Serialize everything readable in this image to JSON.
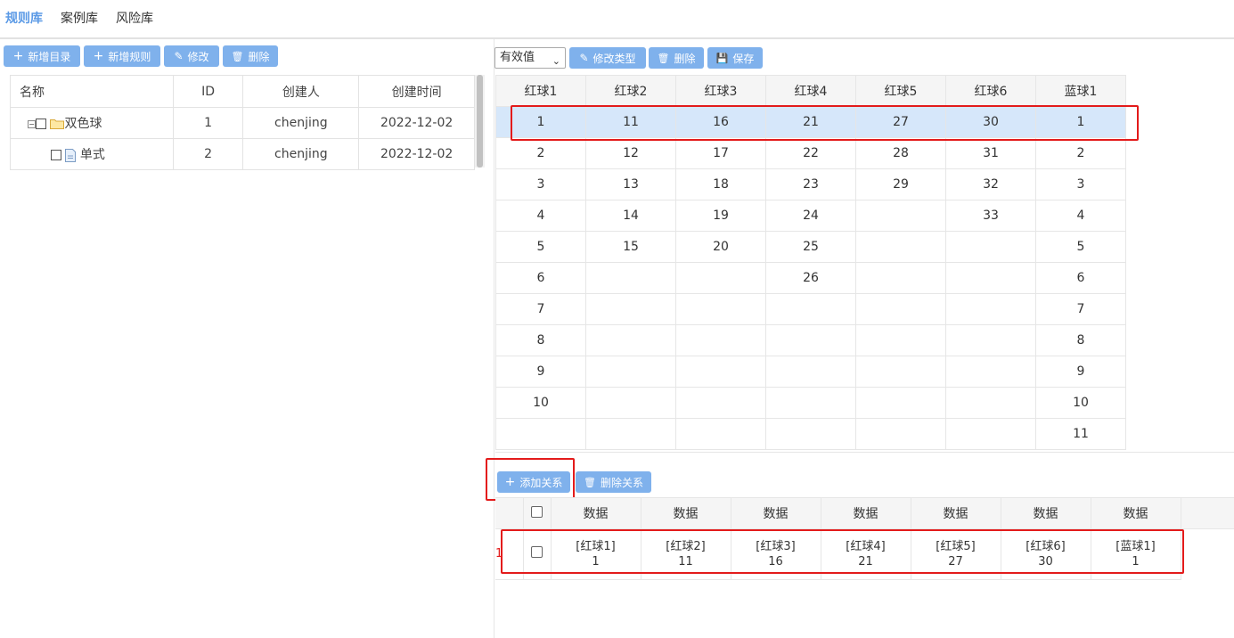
{
  "nav": {
    "tabs": [
      "规则库",
      "案例库",
      "风险库"
    ]
  },
  "left_toolbar": {
    "add_dir": "新增目录",
    "add_rule": "新增规则",
    "edit": "修改",
    "delete": "删除"
  },
  "tree": {
    "headers": [
      "名称",
      "ID",
      "创建人",
      "创建时间"
    ],
    "rows": [
      {
        "name": "双色球",
        "id": "1",
        "creator": "chenjing",
        "created": "2022-12-02"
      },
      {
        "name": "单式",
        "id": "2",
        "creator": "chenjing",
        "created": "2022-12-02"
      }
    ]
  },
  "right_toolbar": {
    "select_value": "有效值",
    "edit_type": "修改类型",
    "delete": "删除",
    "save": "保存"
  },
  "grid": {
    "headers": [
      "红球1",
      "红球2",
      "红球3",
      "红球4",
      "红球5",
      "红球6",
      "蓝球1"
    ],
    "rows": [
      [
        "1",
        "11",
        "16",
        "21",
        "27",
        "30",
        "1"
      ],
      [
        "2",
        "12",
        "17",
        "22",
        "28",
        "31",
        "2"
      ],
      [
        "3",
        "13",
        "18",
        "23",
        "29",
        "32",
        "3"
      ],
      [
        "4",
        "14",
        "19",
        "24",
        "",
        "33",
        "4"
      ],
      [
        "5",
        "15",
        "20",
        "25",
        "",
        "",
        "5"
      ],
      [
        "6",
        "",
        "",
        "26",
        "",
        "",
        "6"
      ],
      [
        "7",
        "",
        "",
        "",
        "",
        "",
        "7"
      ],
      [
        "8",
        "",
        "",
        "",
        "",
        "",
        "8"
      ],
      [
        "9",
        "",
        "",
        "",
        "",
        "",
        "9"
      ],
      [
        "10",
        "",
        "",
        "",
        "",
        "",
        "10"
      ],
      [
        "",
        "",
        "",
        "",
        "",
        "",
        "11"
      ]
    ]
  },
  "relation_toolbar": {
    "add": "添加关系",
    "delete": "删除关系"
  },
  "relations": {
    "header": "数据",
    "row_index": "1",
    "cells": [
      {
        "label": "[红球1]",
        "value": "1"
      },
      {
        "label": "[红球2]",
        "value": "11"
      },
      {
        "label": "[红球3]",
        "value": "16"
      },
      {
        "label": "[红球4]",
        "value": "21"
      },
      {
        "label": "[红球5]",
        "value": "27"
      },
      {
        "label": "[红球6]",
        "value": "30"
      },
      {
        "label": "[蓝球1]",
        "value": "1"
      }
    ]
  },
  "colors": {
    "accent": "#7fb1ec",
    "active_tab": "#5b9ae6",
    "selected_row": "#d6e7fa",
    "highlight": "#e31b1b"
  }
}
